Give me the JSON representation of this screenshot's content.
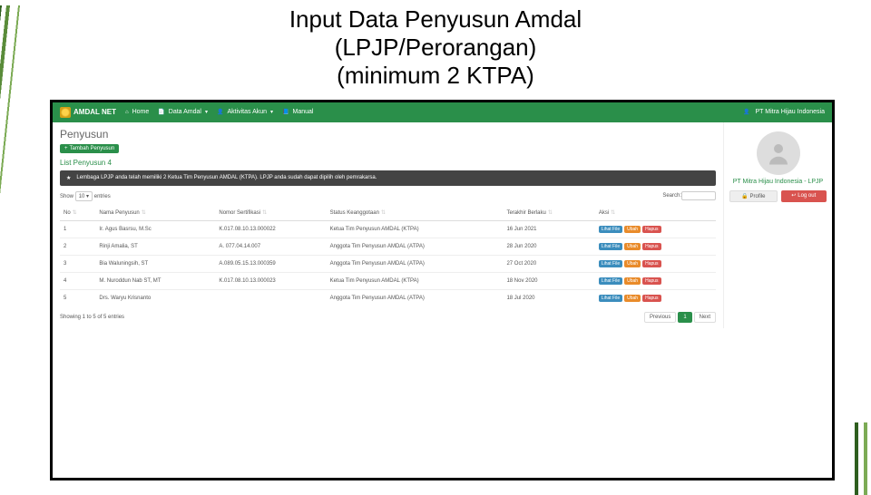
{
  "slide": {
    "title_l1": "Input Data Penyusun Amdal",
    "title_l2": "(LPJP/Perorangan)",
    "title_l3": "(minimum 2 KTPA)"
  },
  "navbar": {
    "brand": "AMDAL NET",
    "items": [
      "Home",
      "Data Amdal",
      "Aktivitas Akun",
      "Manual"
    ],
    "account": "PT Mitra Hijau Indonesia"
  },
  "page": {
    "heading": "Penyusun",
    "add_button": "Tambah Penyusun",
    "list_label": "List Penyusun",
    "list_count": "4",
    "alert": "Lembaga LPJP anda telah memiliki 2 Ketua Tim Penyusun AMDAL (KTPA). LPJP anda sudah dapat dipilih oleh pemrakarsa.",
    "show_prefix": "Show",
    "show_value": "10",
    "show_suffix": "entries",
    "search_label": "Search:",
    "columns": {
      "no": "No",
      "nama": "Nama Penyusun",
      "nomor": "Nomor Sertifikasi",
      "status": "Status Keanggotaan",
      "berlaku": "Terakhir Berlaku",
      "aksi": "Aksi"
    },
    "rows": [
      {
        "no": "1",
        "nama": "Ir. Agus Basrsu, M.Sc",
        "nomor": "K.017.08.10.13.000022",
        "status": "Ketua Tim Penyusun AMDAL (KTPA)",
        "berlaku": "16 Jun 2021"
      },
      {
        "no": "2",
        "nama": "Rinji Amalia, ST",
        "nomor": "A. 077.04.14.007",
        "status": "Anggota Tim Penyusun AMDAL (ATPA)",
        "berlaku": "28 Jun 2020"
      },
      {
        "no": "3",
        "nama": "Bia Waluningsih, ST",
        "nomor": "A.089.05.15.13.000359",
        "status": "Anggota Tim Penyusun AMDAL (ATPA)",
        "berlaku": "27 Oct 2020"
      },
      {
        "no": "4",
        "nama": "M. Nuroddun Nab ST, MT",
        "nomor": "K.017.08.10.13.000023",
        "status": "Ketua Tim Penyusun AMDAL (KTPA)",
        "berlaku": "18 Nov 2020"
      },
      {
        "no": "5",
        "nama": "Drs. Waryu Krisnanto",
        "nomor": "",
        "status": "Anggota Tim Penyusun AMDAL (ATPA)",
        "berlaku": "18 Jul 2020"
      }
    ],
    "aksi": {
      "lihat": "Lihat File",
      "ubah": "Ubah",
      "hapus": "Hapus"
    },
    "footer_info": "Showing 1 to 5 of 5 entries",
    "pager": {
      "prev": "Previous",
      "page": "1",
      "next": "Next"
    }
  },
  "sidebar": {
    "company": "PT Mitra Hijau Indonesia - LPJP",
    "profile_btn": "Profile",
    "logout_btn": "Log out"
  }
}
